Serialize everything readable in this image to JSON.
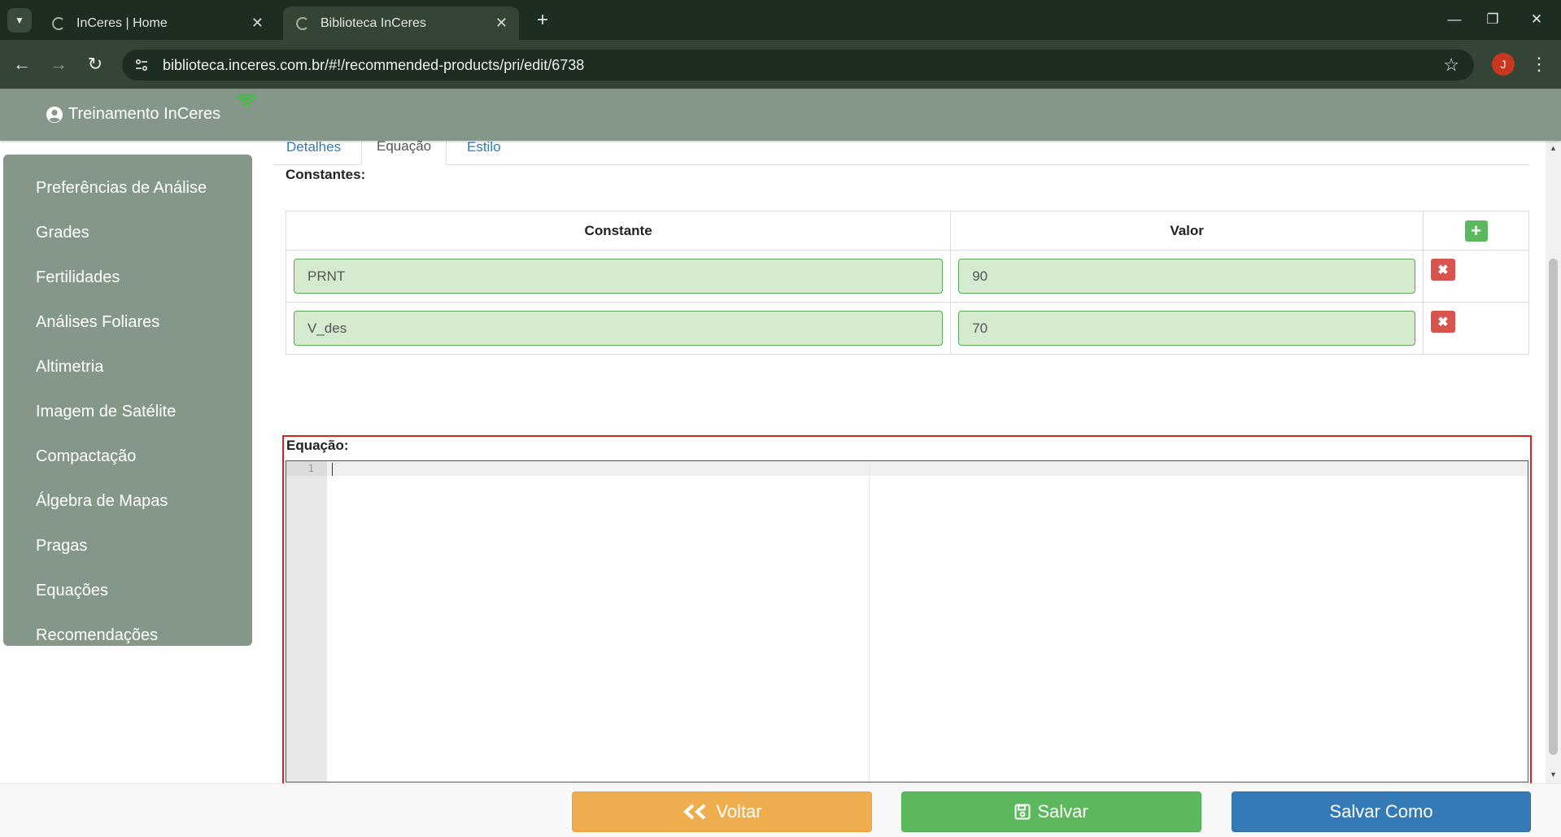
{
  "browser": {
    "tabs": [
      {
        "title": "InCeres | Home",
        "active": false
      },
      {
        "title": "Biblioteca InCeres",
        "active": true
      }
    ],
    "url": "biblioteca.inceres.com.br/#!/recommended-products/pri/edit/6738",
    "profile_initial": "J"
  },
  "header": {
    "user_name": "Treinamento InCeres"
  },
  "sidebar": {
    "items": [
      {
        "label": "Preferências de Análise"
      },
      {
        "label": "Grades"
      },
      {
        "label": "Fertilidades"
      },
      {
        "label": "Análises Foliares"
      },
      {
        "label": "Altimetria"
      },
      {
        "label": "Imagem de Satélite"
      },
      {
        "label": "Compactação"
      },
      {
        "label": "Álgebra de Mapas"
      },
      {
        "label": "Pragas"
      },
      {
        "label": "Equações"
      },
      {
        "label": "Recomendações"
      }
    ]
  },
  "content_tabs": [
    {
      "label": "Detalhes",
      "active": false
    },
    {
      "label": "Equação",
      "active": true
    },
    {
      "label": "Estilo",
      "active": false
    }
  ],
  "constants": {
    "label": "Constantes:",
    "columns": {
      "name": "Constante",
      "value": "Valor"
    },
    "rows": [
      {
        "name": "PRNT",
        "value": "90"
      },
      {
        "name": "V_des",
        "value": "70"
      }
    ]
  },
  "equation": {
    "label": "Equação:",
    "line_number": "1",
    "content": ""
  },
  "footer": {
    "back_label": "Voltar",
    "save_label": "Salvar",
    "save_as_label": "Salvar Como"
  },
  "colors": {
    "chrome_dark": "#1e2d1f",
    "chrome_mid": "#344535",
    "app_header": "#849789",
    "field_bg": "#d4ebd0",
    "btn_warning": "#f0ad4e",
    "btn_success": "#5cb85c",
    "btn_primary": "#337ab7",
    "btn_danger": "#d9534f",
    "highlight_frame": "#e0201f"
  }
}
